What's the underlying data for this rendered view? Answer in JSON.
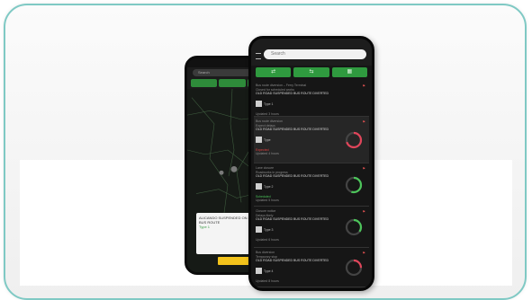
{
  "search": {
    "placeholder": "Search"
  },
  "back_phone": {
    "search_placeholder": "Search",
    "popup": {
      "line1": "ALICANDO SUSPENDED ON 4.1",
      "line2": "BUS ROUTE",
      "line3": "Type 1",
      "button": "View Details"
    }
  },
  "tabs": [
    {
      "name": "tab-map",
      "label": "⇄"
    },
    {
      "name": "tab-list",
      "label": "⇆"
    },
    {
      "name": "tab-grid",
      "label": "▦"
    }
  ],
  "items": [
    {
      "lines": [
        "Bus route diversion – Ferry Terminal",
        "Closed for scheduled works"
      ],
      "title": "OLD ROAD SUSPENDED BUS ROUTE DIVERTED",
      "tag": "Type 1",
      "status": "",
      "status_kind": "",
      "meta": "Updated 3 hours",
      "gauge": null
    },
    {
      "lines": [
        "Bus route diversion",
        "Expect delays"
      ],
      "title": "OLD ROAD SUSPENDED BUS ROUTE DIVERTED",
      "tag": "Type",
      "status": "Expected",
      "status_kind": "red",
      "meta": "Updated 4 hours",
      "gauge": {
        "percent": 0.7,
        "color": "#e0455a"
      }
    },
    {
      "lines": [
        "Lane closure",
        "Roadworks in progress"
      ],
      "title": "OLD ROAD SUSPENDED BUS ROUTE DIVERTED",
      "tag": "Type 2",
      "status": "Scheduled",
      "status_kind": "green",
      "meta": "Updated 5 hours",
      "gauge": {
        "percent": 0.55,
        "color": "#4cc45a"
      }
    },
    {
      "lines": [
        "Closure notice",
        "Delays likely"
      ],
      "title": "OLD ROAD SUSPENDED BUS ROUTE DIVERTED",
      "tag": "Type 3",
      "status": "",
      "status_kind": "",
      "meta": "Updated 6 hours",
      "gauge": {
        "percent": 0.35,
        "color": "#4cc45a"
      }
    },
    {
      "lines": [
        "Bus diversion",
        "Temporary stop"
      ],
      "title": "OLD ROAD SUSPENDED BUS ROUTE DIVERTED",
      "tag": "Type 4",
      "status": "",
      "status_kind": "",
      "meta": "Updated 8 hours",
      "gauge": {
        "percent": 0.25,
        "color": "#e0455a"
      }
    }
  ],
  "colors": {
    "accent": "#2f9a3f",
    "card_border": "#7fc9c4",
    "popup_button": "#f2c31b"
  }
}
